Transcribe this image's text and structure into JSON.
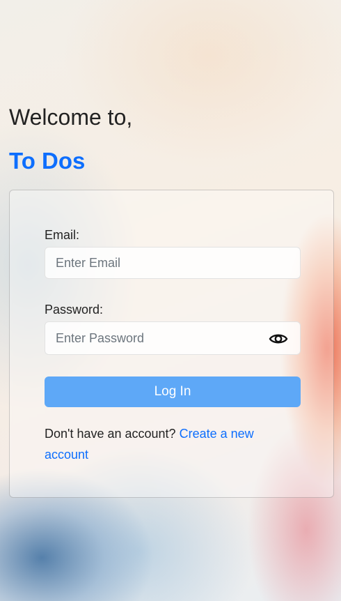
{
  "header": {
    "welcome_text": "Welcome to,",
    "app_name": "To Dos"
  },
  "form": {
    "email_label": "Email:",
    "email_placeholder": "Enter Email",
    "email_value": "",
    "password_label": "Password:",
    "password_placeholder": "Enter Password",
    "password_value": "",
    "password_toggle_icon": "eye-icon",
    "login_label": "Log In",
    "signup_prompt": "Don't have an account?",
    "signup_link": "Create a new account"
  },
  "colors": {
    "brand": "#0d6efd",
    "button": "#5ea8f7"
  }
}
